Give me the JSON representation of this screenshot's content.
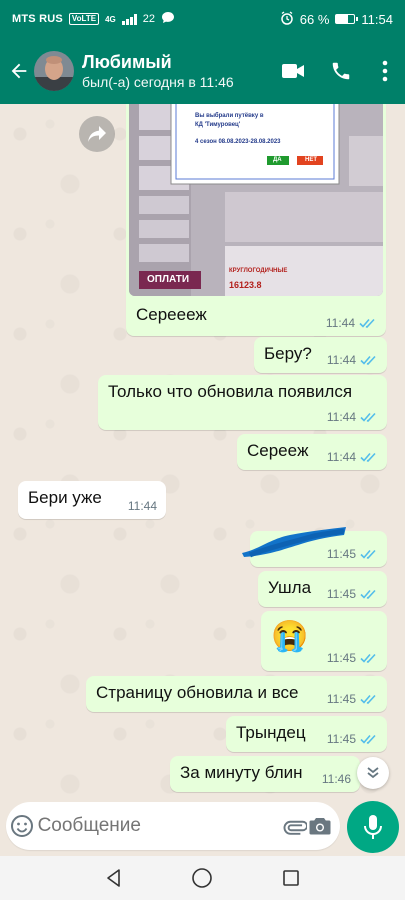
{
  "status_bar": {
    "carrier": "MTS RUS",
    "volte": "VoLTE",
    "network": "4G",
    "signal2": "22",
    "battery": "66 %",
    "battery_level": 0.66,
    "time": "11:54"
  },
  "header": {
    "name": "Любимый",
    "status": "был(-а) сегодня в 11:46"
  },
  "screenshot_in_chat": {
    "dialog_line1": "Вы выбрали путёвку в",
    "dialog_line2": "КД 'Тимуровец'",
    "dialog_line3": "4 сезон 08.08.2023-28.08.2023",
    "yes": "ДА",
    "no": "НЕТ",
    "pay": "ОПЛАТИ",
    "price_label": "КРУГЛОГОДИЧНЫЕ",
    "price": "16123.8"
  },
  "messages": [
    {
      "text": "Сереееж",
      "time": "11:44",
      "dir": "out"
    },
    {
      "text": "Беру?",
      "time": "11:44",
      "dir": "out"
    },
    {
      "text": "Только что обновила появился",
      "time": "11:44",
      "dir": "out"
    },
    {
      "text": "Сереeж",
      "time": "11:44",
      "dir": "out"
    },
    {
      "text": "Бери уже",
      "time": "11:44",
      "dir": "in"
    },
    {
      "text": "",
      "time": "11:45",
      "dir": "out"
    },
    {
      "text": "Ушла",
      "time": "11:45",
      "dir": "out"
    },
    {
      "text": "😭",
      "time": "11:45",
      "dir": "out"
    },
    {
      "text": "Страницу обновила и все",
      "time": "11:45",
      "dir": "out"
    },
    {
      "text": "Трындец",
      "time": "11:45",
      "dir": "out"
    },
    {
      "text": "За минуту блин",
      "time": "11:46",
      "dir": "out"
    }
  ],
  "input": {
    "placeholder": "Сообщение"
  },
  "colors": {
    "brand": "#008069",
    "outgoing_bubble": "#e7ffdb",
    "incoming_bubble": "#ffffff",
    "read_ticks": "#53bdeb",
    "mic_button": "#00a884"
  },
  "icons": [
    "back-arrow-icon",
    "video-call-icon",
    "phone-icon",
    "more-vert-icon",
    "forward-icon",
    "emoji-icon",
    "attach-icon",
    "camera-icon",
    "mic-icon",
    "scroll-down-icon",
    "nav-back-icon",
    "nav-home-icon",
    "nav-recents-icon"
  ]
}
